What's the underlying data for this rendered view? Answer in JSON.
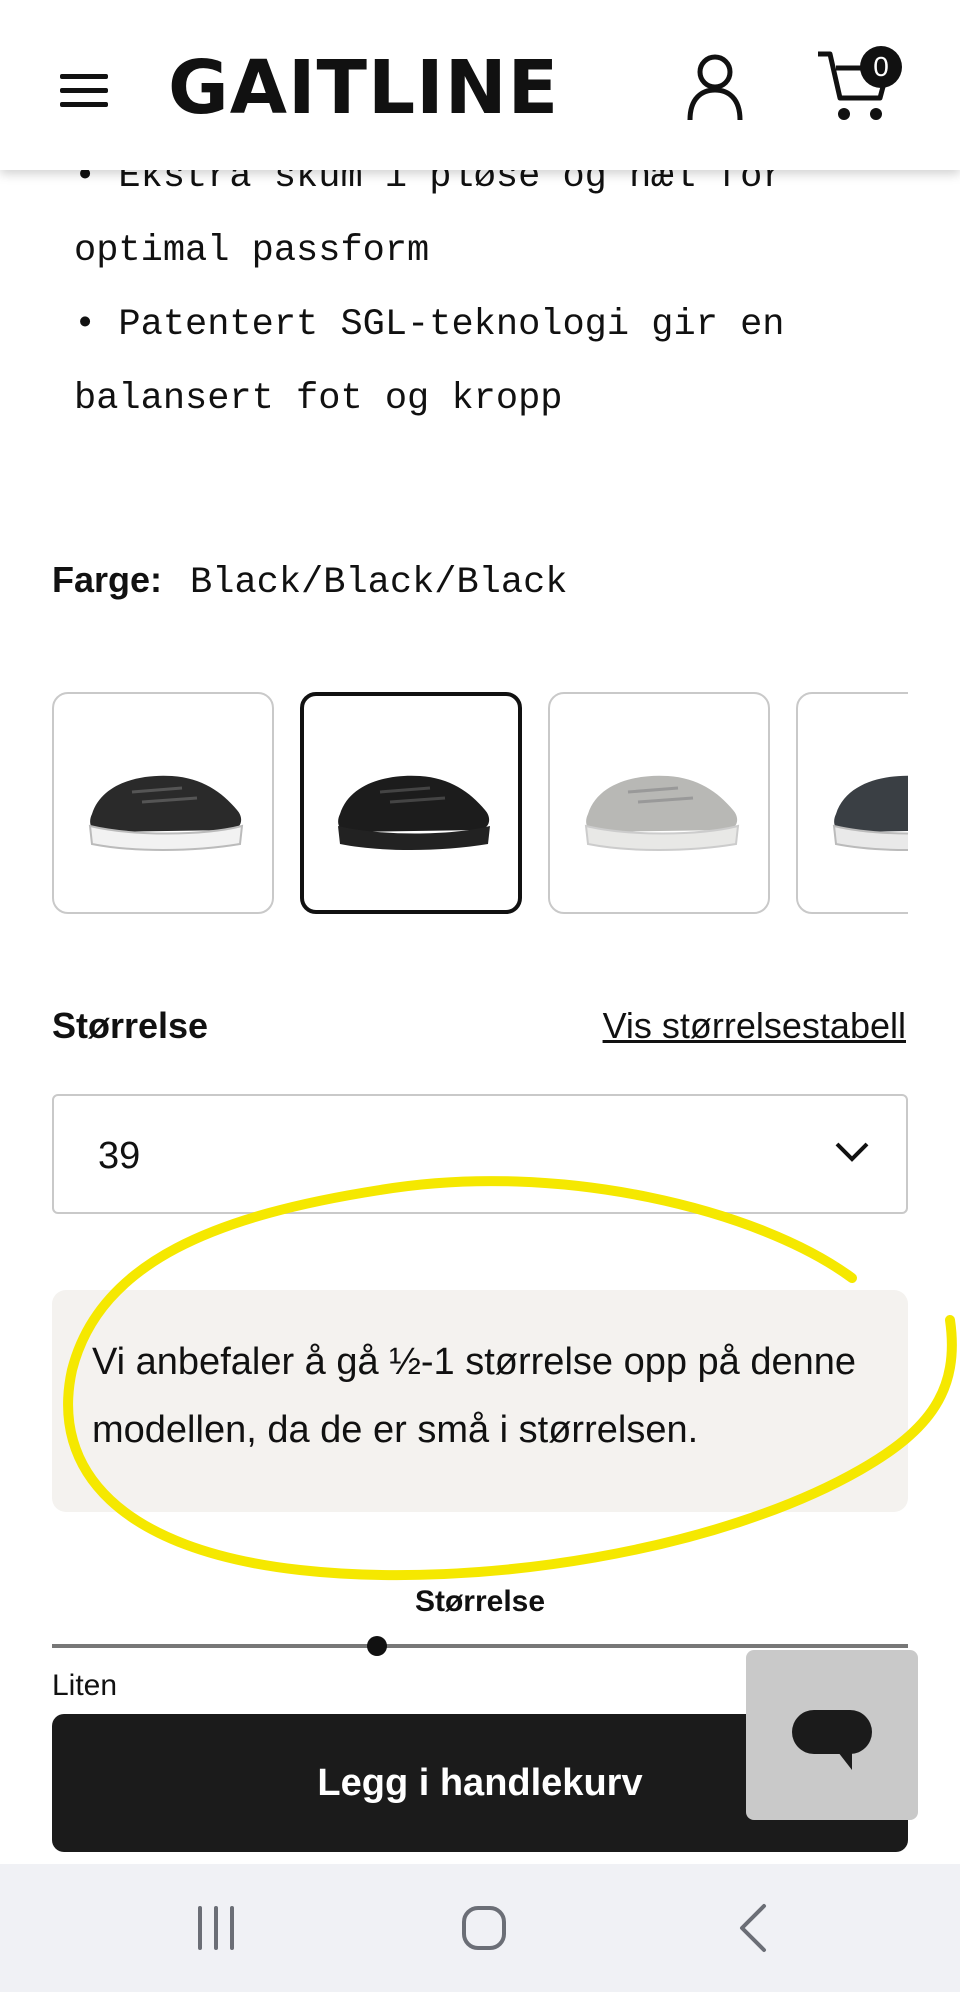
{
  "header": {
    "logo": "GAITLINE",
    "cart_count": "0",
    "icons": [
      "hamburger-menu-icon",
      "account-icon",
      "cart-icon"
    ]
  },
  "description": {
    "lines": [
      "•  Ekstra skum i pløse og hæl for",
      "optimal passform",
      "•  Patentert SGL-teknologi gir en",
      "balansert fot og kropp"
    ]
  },
  "color": {
    "label": "Farge:",
    "value": "Black/Black/Black",
    "swatches": [
      {
        "name": "black-white-sole",
        "upper": "#2a2a2a",
        "sole": "#f2f2f2",
        "selected": false
      },
      {
        "name": "black-black",
        "upper": "#1c1c1c",
        "sole": "#222222",
        "selected": true
      },
      {
        "name": "grey",
        "upper": "#b8b8b5",
        "sole": "#e8e8e6",
        "selected": false
      },
      {
        "name": "dark-mint",
        "upper": "#3a3f44",
        "sole": "#e9e9e9",
        "selected": false
      }
    ]
  },
  "size": {
    "label": "Størrelse",
    "table_link": "Vis størrelsestabell",
    "selected": "39"
  },
  "recommendation": {
    "text": "Vi anbefaler å gå ½-1 størrelse opp på denne modellen, da de er små i størrelsen."
  },
  "fit": {
    "title": "Størrelse",
    "min_label": "Liten",
    "level": 0.38
  },
  "cart": {
    "add_label": "Legg i handlekurv"
  },
  "colors": {
    "highlight": "#f5e800",
    "button": "#1b1b1b",
    "reco_bg": "#f4f2ef"
  }
}
